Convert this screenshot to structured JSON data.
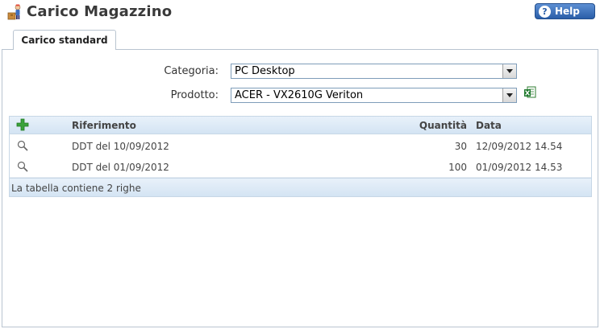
{
  "header": {
    "title": "Carico Magazzino",
    "help_label": "Help",
    "help_glyph": "?"
  },
  "tabs": [
    {
      "label": "Carico standard",
      "active": true
    }
  ],
  "form": {
    "category_label": "Categoria:",
    "category_value": "PC Desktop",
    "product_label": "Prodotto:",
    "product_value": "ACER - VX2610G Veriton"
  },
  "table": {
    "columns": {
      "reference": "Riferimento",
      "quantity": "Quantità",
      "date": "Data"
    },
    "rows": [
      {
        "reference": "DDT del 10/09/2012",
        "quantity": "30",
        "date": "12/09/2012 14.54"
      },
      {
        "reference": "DDT del 01/09/2012",
        "quantity": "100",
        "date": "01/09/2012 14.53"
      }
    ],
    "footer": "La tabella contiene 2 righe"
  },
  "colors": {
    "accent": "#2a5ea8",
    "header_bg": "#d4e4f3",
    "add_green": "#3aa23a"
  },
  "icons": {
    "app": "warehouse-worker-icon",
    "add": "plus-icon",
    "row_action": "magnifier-icon",
    "export": "excel-icon"
  }
}
